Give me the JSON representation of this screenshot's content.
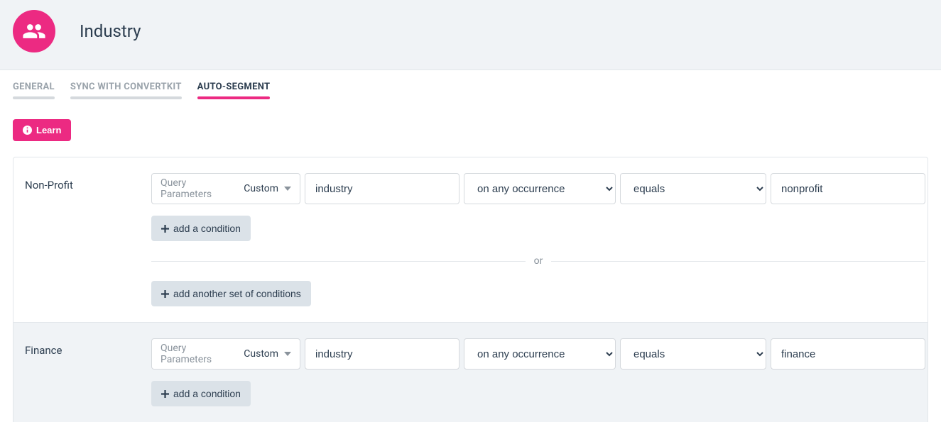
{
  "header": {
    "title": "Industry"
  },
  "tabs": [
    {
      "label": "GENERAL",
      "active": false
    },
    {
      "label": "SYNC WITH CONVERTKIT",
      "active": false
    },
    {
      "label": "AUTO-SEGMENT",
      "active": true
    }
  ],
  "learn_button": "Learn",
  "segments": [
    {
      "name": "Non-Profit",
      "condition": {
        "source_label": "Query Parameters",
        "source_value": "Custom",
        "param": "industry",
        "occurrence": "on any occurrence",
        "operator": "equals",
        "value": "nonprofit"
      },
      "add_condition": "add a condition",
      "or_label": "or",
      "add_set": "add another set of conditions"
    },
    {
      "name": "Finance",
      "condition": {
        "source_label": "Query Parameters",
        "source_value": "Custom",
        "param": "industry",
        "occurrence": "on any occurrence",
        "operator": "equals",
        "value": "finance"
      },
      "add_condition": "add a condition"
    }
  ]
}
